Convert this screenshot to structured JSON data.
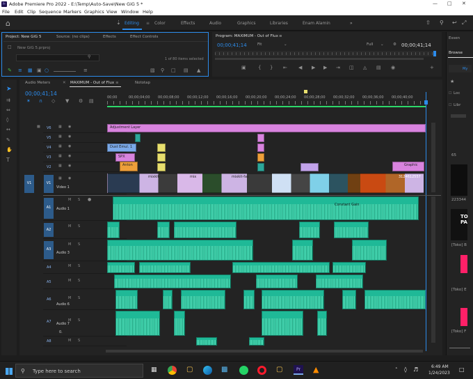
{
  "app": {
    "title": "Adobe Premiere Pro 2022 - E:\\Temp\\Auto-Save\\New GiG 5 *",
    "icon_text": "Pr"
  },
  "menu": [
    "File",
    "Edit",
    "Clip",
    "Sequence",
    "Markers",
    "Graphics",
    "View",
    "Window",
    "Help"
  ],
  "workspaces": [
    "Editing",
    "Color",
    "Effects",
    "Audio",
    "Graphics",
    "Libraries",
    "Enam Alamin"
  ],
  "active_workspace": "Editing",
  "project_panel": {
    "tabs": [
      "Project: New GiG 5",
      "Source: (no clips)",
      "Effects",
      "Effect Controls"
    ],
    "file": "New GiG 5.prproj",
    "status": "1 of 80 items selected"
  },
  "program_monitor": {
    "title": "Program: MAXIMUM - Out of Flux",
    "timecode_left": "00;00;41;14",
    "zoom": "Fit",
    "resolution": "Full",
    "timecode_right": "00;00;41;14"
  },
  "timeline": {
    "panel_tabs": [
      "Audio Meters",
      "MAXIMUM - Out of Flux",
      "Nototap"
    ],
    "timecode": "00;00;41;14",
    "ruler": [
      "00;00",
      "00;00;04;00",
      "00;00;08;00",
      "00;00;12;00",
      "00;00;16;00",
      "00;00;20;00",
      "00;00;24;00",
      "00;00;28;00",
      "00;00;32;00",
      "00;00;36;00",
      "00;00;40;00"
    ],
    "video_tracks": [
      "V6",
      "V5",
      "V4",
      "V3",
      "V2",
      "V1"
    ],
    "audio_tracks": [
      "A1",
      "A2",
      "A3",
      "A4",
      "A5",
      "A6",
      "A7",
      "A8"
    ],
    "track_names": {
      "V1": "Video 1",
      "A1": "Audio 1",
      "A3": "Audio 3",
      "A6": "Audio 6",
      "A7": "Audio 7"
    },
    "source_patch": "V1",
    "a7_volume": "0.",
    "clip_labels": {
      "adjustment": "Adjustment Layer",
      "dust": "Dust Emul. 1",
      "spx": "SPX",
      "anton": "Anton",
      "graphic": "Graphic",
      "mixkit1": "mixkit-",
      "mixkit2": "mix",
      "mixkit3": "mixkit-fas",
      "clip_num": "3124612557",
      "constant": "Constant Gain"
    }
  },
  "right_panel": {
    "title": "Essen",
    "tab": "Browse",
    "tab2": "My",
    "checks": [
      "Loc",
      "Libr"
    ],
    "items": [
      "65",
      "223344",
      "[Toko] B",
      "[Toko] E",
      "[Toko] F"
    ],
    "thumb_text": "TO PA"
  },
  "taskbar": {
    "search_placeholder": "Type here to search",
    "time": "6:49 AM",
    "date": "1/24/2023"
  }
}
